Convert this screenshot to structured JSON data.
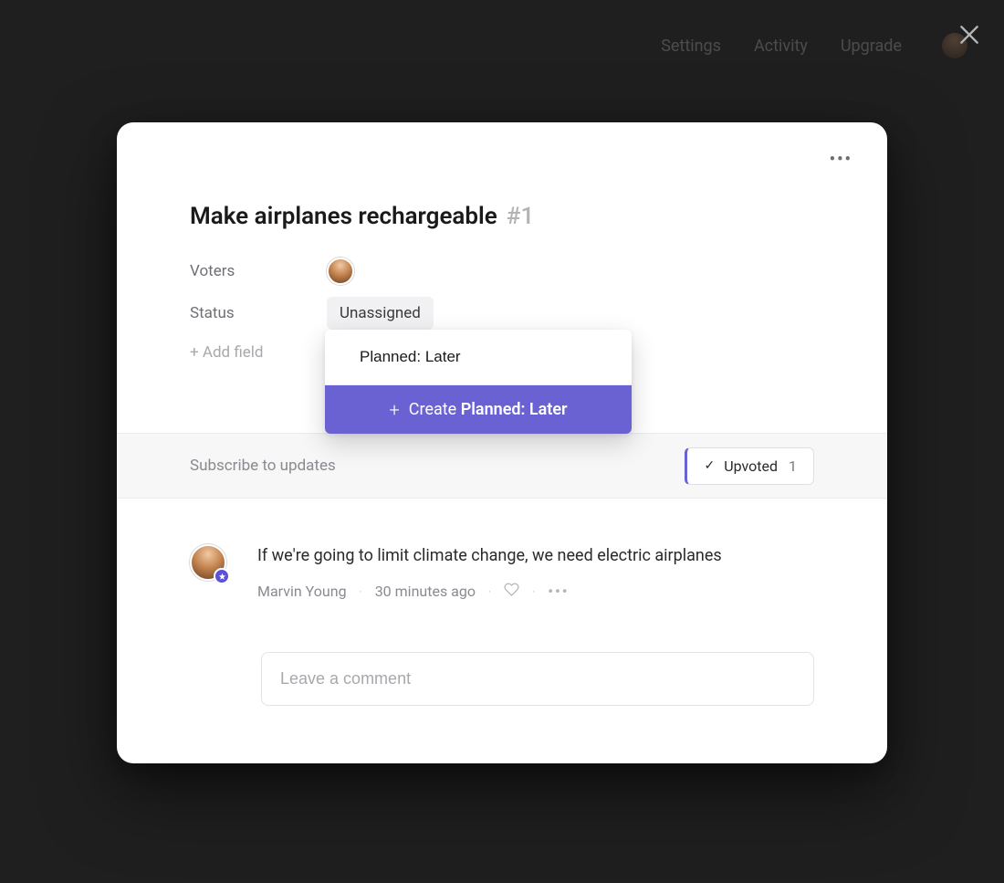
{
  "header": {
    "nav": [
      "Settings",
      "Activity",
      "Upgrade"
    ]
  },
  "modal": {
    "title": "Make airplanes rechargeable",
    "id_label": "#1",
    "fields": {
      "voters_label": "Voters",
      "status_label": "Status",
      "status_value": "Unassigned",
      "add_field_label": "+ Add field"
    },
    "dropdown": {
      "input_value": "Planned: Later",
      "create_prefix": "Create",
      "create_value": "Planned: Later"
    },
    "subscribe": {
      "text": "Subscribe to updates",
      "upvoted_label": "Upvoted",
      "upvoted_count": "1"
    },
    "comment": {
      "text": "If we're going to limit climate change, we need electric airplanes",
      "author": "Marvin Young",
      "time": "30 minutes ago"
    },
    "comment_input_placeholder": "Leave a comment"
  }
}
